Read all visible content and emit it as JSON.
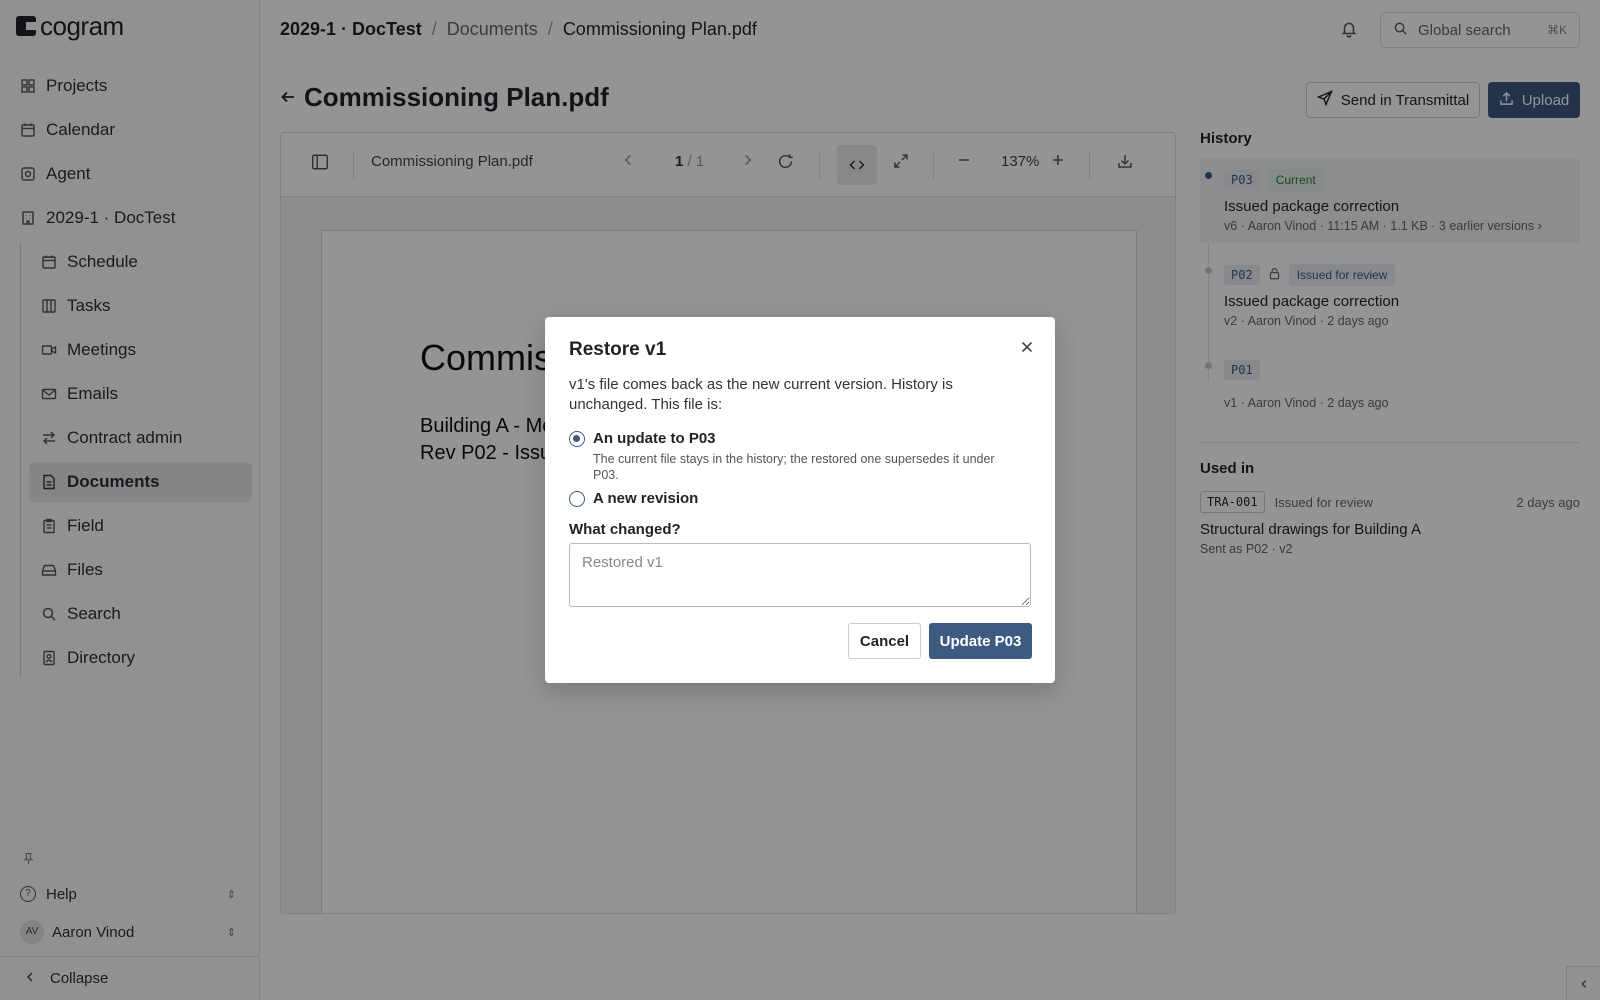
{
  "app": {
    "logo_text": "cogram"
  },
  "sidebar": {
    "items": [
      {
        "label": "Projects",
        "icon": "grid-icon"
      },
      {
        "label": "Calendar",
        "icon": "calendar-icon"
      },
      {
        "label": "Agent",
        "icon": "agent-icon"
      },
      {
        "label": "2029-1 · DocTest",
        "icon": "building-icon"
      }
    ],
    "sub_items": [
      {
        "label": "Schedule",
        "icon": "calendar-icon"
      },
      {
        "label": "Tasks",
        "icon": "columns-icon"
      },
      {
        "label": "Meetings",
        "icon": "video-icon"
      },
      {
        "label": "Emails",
        "icon": "mail-icon"
      },
      {
        "label": "Contract admin",
        "icon": "swap-icon"
      },
      {
        "label": "Documents",
        "icon": "document-icon",
        "active": true
      },
      {
        "label": "Field",
        "icon": "clipboard-icon"
      },
      {
        "label": "Files",
        "icon": "drive-icon"
      },
      {
        "label": "Search",
        "icon": "search-icon"
      },
      {
        "label": "Directory",
        "icon": "directory-icon"
      }
    ],
    "help_label": "Help",
    "user_initials": "AV",
    "user_name": "Aaron Vinod",
    "collapse_label": "Collapse"
  },
  "topbar": {
    "breadcrumb": [
      "2029-1 · DocTest",
      "Documents",
      "Commissioning Plan.pdf"
    ],
    "search_placeholder": "Global search",
    "search_shortcut": "⌘K"
  },
  "document": {
    "title": "Commissioning Plan.pdf",
    "send_button": "Send in Transmittal",
    "upload_button": "Upload"
  },
  "viewer": {
    "filename": "Commissioning Plan.pdf",
    "page_current": "1",
    "page_total": "/ 1",
    "zoom": "137%",
    "page_heading": "Commiss",
    "page_line1": "Building A - Me",
    "page_line2": "Rev P02 - Issu"
  },
  "history": {
    "heading": "History",
    "entries": [
      {
        "code": "P03",
        "status": "Current",
        "title": "Issued package correction",
        "meta": "v6 · Aaron Vinod · 11:15 AM · 1.1 KB · 3 earlier versions ›"
      },
      {
        "code": "P02",
        "status": "Issued for review",
        "title": "Issued package correction",
        "meta": "v2 · Aaron Vinod · 2 days ago"
      },
      {
        "code": "P01",
        "meta": "v1 · Aaron Vinod · 2 days ago"
      }
    ]
  },
  "used_in": {
    "heading": "Used in",
    "code": "TRA-001",
    "status": "Issued for review",
    "date": "2 days ago",
    "title": "Structural drawings for Building A",
    "meta": "Sent as P02 · v2"
  },
  "modal": {
    "title": "Restore v1",
    "description": "v1's file comes back as the new current version. History is unchanged. This file is:",
    "option_update_label": "An update to P03",
    "option_update_help": "The current file stays in the history; the restored one supersedes it under P03.",
    "option_revision_label": "A new revision",
    "selected": "update",
    "field_label": "What changed?",
    "field_placeholder": "Restored v1",
    "cancel_label": "Cancel",
    "confirm_label": "Update P03"
  },
  "colors": {
    "accent": "#3d5a80",
    "current_badge": "#2f7a3d"
  }
}
